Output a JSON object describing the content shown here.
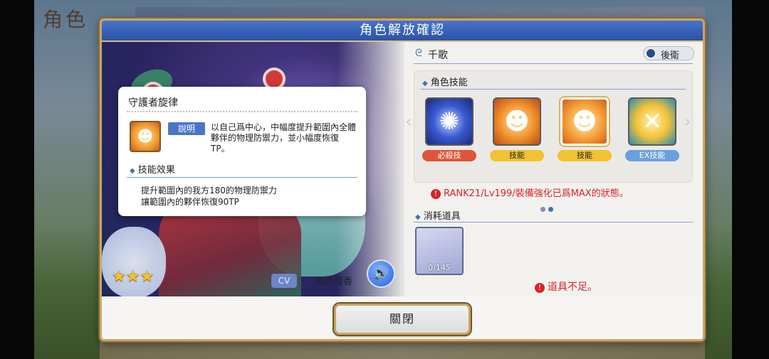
{
  "background": {
    "title": "角色"
  },
  "modal": {
    "title": "角色解放確認",
    "close_label": "關閉"
  },
  "character": {
    "name": "千歌",
    "role": "後衛",
    "stars": 3,
    "cv_label": "CV",
    "voice_actor": "福原綾香"
  },
  "skills": {
    "section_label": "角色技能",
    "items": [
      {
        "tag": "必殺技",
        "tag_color": "#e0553a",
        "icon": "vortex-icon"
      },
      {
        "tag": "技能",
        "tag_color": "#f1c232",
        "icon": "fire-shield-icon"
      },
      {
        "tag": "技能",
        "tag_color": "#f1c232",
        "icon": "fire-shield-icon"
      },
      {
        "tag": "EX技能",
        "tag_color": "#6aa0e0",
        "icon": "crossed-swords-icon"
      }
    ],
    "selected_index": 2
  },
  "warning": {
    "rank_requirement": "RANK21/Lv199/裝備強化已爲MAX的狀態。"
  },
  "consumables": {
    "section_label": "消耗道具",
    "count": "0/145",
    "insufficient": "道具不足。"
  },
  "tooltip": {
    "title": "守護者旋律",
    "desc_tag": "說明",
    "description": "以自己爲中心，中幅度提升範圍內全體夥伴的物理防禦力，並小幅度恢復TP。",
    "effect_label": "技能效果",
    "effect_line1": "提升範圍內的我方180的物理防禦力",
    "effect_line2": "讓範圍內的夥伴恢復90TP"
  },
  "colors": {
    "header_blue": "#3560b6",
    "gold_border": "#c7a86a",
    "warning_red": "#d8232a"
  }
}
